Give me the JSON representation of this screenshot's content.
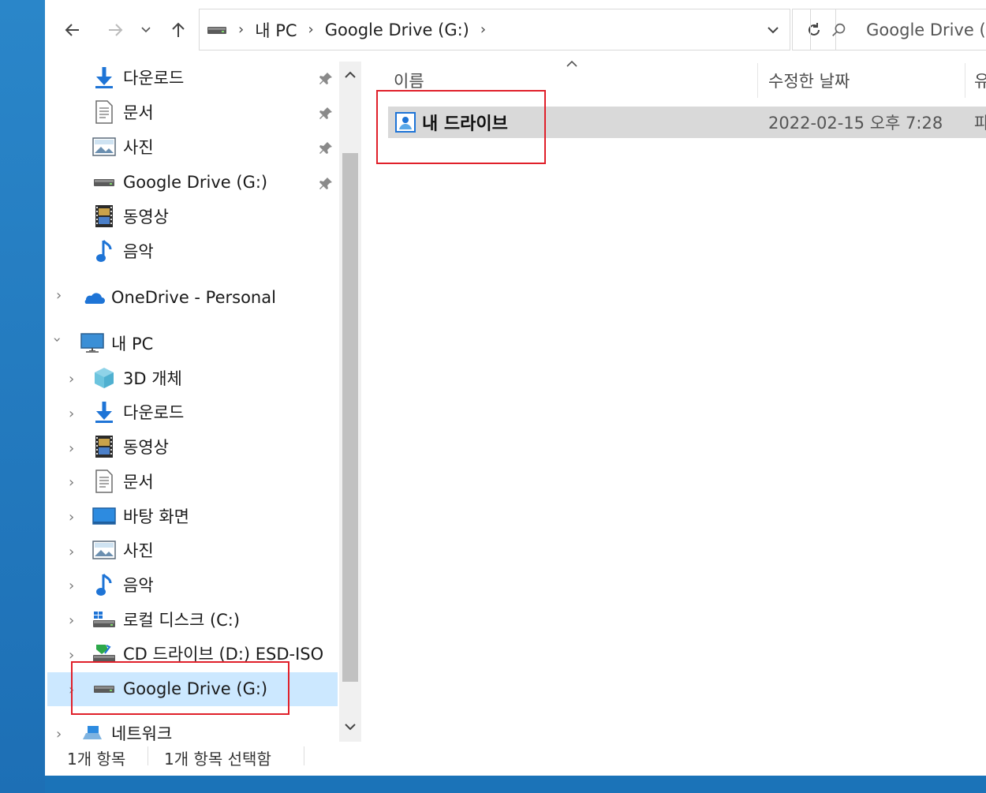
{
  "toolbar": {
    "back_icon": "arrow-left-icon",
    "forward_icon": "arrow-right-icon",
    "recent_icon": "chevron-down-icon",
    "up_icon": "arrow-up-icon",
    "breadcrumb": [
      "내 PC",
      "Google Drive (G:)"
    ],
    "search_placeholder": "Google Drive (G:) 검색",
    "search_visible": "Google Drive (G"
  },
  "nav": {
    "quick_access": [
      {
        "label": "다운로드",
        "icon": "download-arrow-icon",
        "pinned": true
      },
      {
        "label": "문서",
        "icon": "document-icon",
        "pinned": true
      },
      {
        "label": "사진",
        "icon": "pictures-icon",
        "pinned": true
      },
      {
        "label": "Google Drive (G:)",
        "icon": "drive-icon",
        "pinned": true
      },
      {
        "label": "동영상",
        "icon": "video-icon",
        "pinned": false
      },
      {
        "label": "음악",
        "icon": "music-note-icon",
        "pinned": false
      }
    ],
    "onedrive": "OneDrive - Personal",
    "this_pc": "내 PC",
    "pc_items": [
      {
        "label": "3D 개체",
        "icon": "3d-objects-icon"
      },
      {
        "label": "다운로드",
        "icon": "download-arrow-icon"
      },
      {
        "label": "동영상",
        "icon": "video-icon"
      },
      {
        "label": "문서",
        "icon": "document-icon"
      },
      {
        "label": "바탕 화면",
        "icon": "desktop-icon"
      },
      {
        "label": "사진",
        "icon": "pictures-icon"
      },
      {
        "label": "음악",
        "icon": "music-note-icon"
      },
      {
        "label": "로컬 디스크 (C:)",
        "icon": "local-disk-icon"
      },
      {
        "label": "CD 드라이브 (D:) ESD-ISO",
        "icon": "cd-drive-icon"
      },
      {
        "label": "Google Drive (G:)",
        "icon": "drive-icon"
      }
    ],
    "network": "네트워크"
  },
  "list": {
    "columns": {
      "name": "이름",
      "modified": "수정한 날짜",
      "type": "유"
    },
    "rows": [
      {
        "name": "내 드라이브",
        "modified": "2022-02-15 오후 7:28",
        "type": "파"
      }
    ]
  },
  "status": {
    "count": "1개 항목",
    "selected": "1개 항목 선택함"
  },
  "colors": {
    "selection": "#cce8ff",
    "highlight_box": "#e0202a",
    "row_selected": "#d9d9d9"
  }
}
